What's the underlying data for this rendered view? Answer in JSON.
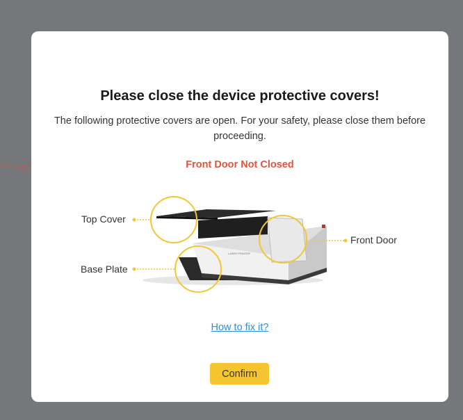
{
  "dialog": {
    "title": "Please close the device protective covers!",
    "description": "The following protective covers are open. For your safety, please close them before proceeding.",
    "status": "Front Door Not Closed",
    "callouts": {
      "top_cover": "Top Cover",
      "base_plate": "Base Plate",
      "front_door": "Front Door"
    },
    "help_link": "How to fix it?",
    "confirm_label": "Confirm"
  },
  "colors": {
    "overlay": "#75777b",
    "status_red": "#e5533d",
    "accent_yellow": "#f5c530",
    "link_blue": "#2f8fd8"
  },
  "icons": [
    "device-illustration",
    "callout-circle"
  ]
}
